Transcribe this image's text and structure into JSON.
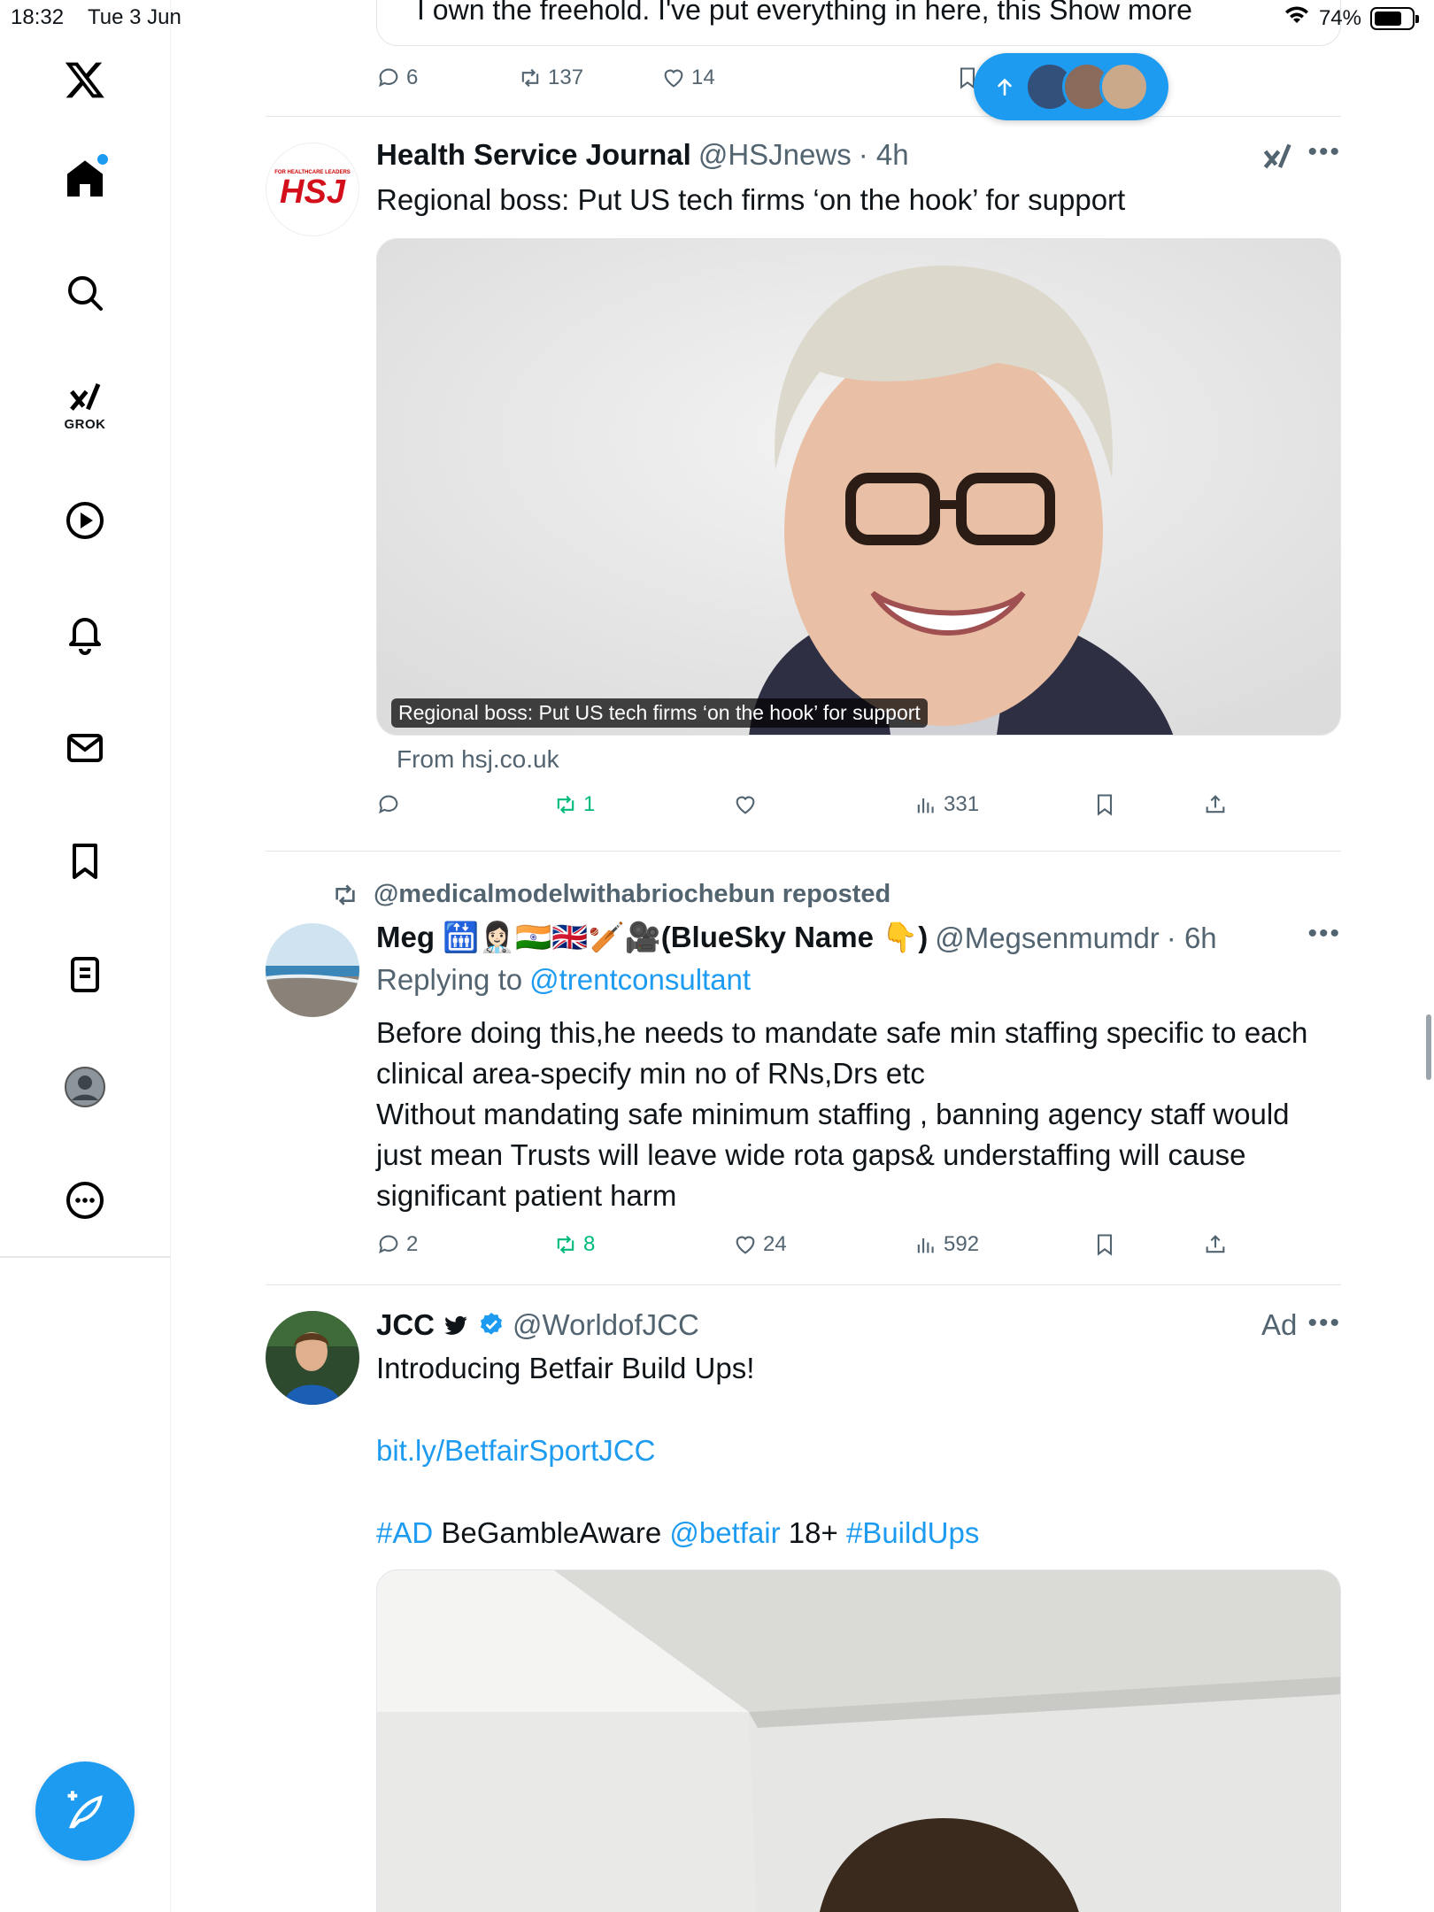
{
  "status_bar": {
    "time": "18:32",
    "date": "Tue 3 Jun",
    "battery_percent": "74%",
    "battery_level": 0.74
  },
  "sidebar": {
    "grok_label": "GROK",
    "items": [
      "x-logo",
      "home",
      "search",
      "grok",
      "video",
      "notifications",
      "messages",
      "bookmarks",
      "lists",
      "profile",
      "more"
    ]
  },
  "new_posts_pill": {
    "accent": "#1d9bf0"
  },
  "prev_tweet": {
    "text_partial": "I own the freehold. I've put everything in here, this",
    "show_more": "Show more",
    "replies": "6",
    "reposts": "137",
    "likes": "14"
  },
  "tweets": [
    {
      "name": "Health Service Journal",
      "handle": "@HSJnews",
      "time": "· 4h",
      "text": "Regional boss: Put US tech firms ‘on the hook’ for support",
      "avatar_text": "HSJ",
      "avatar_subtext": "FOR HEALTHCARE LEADERS",
      "card_caption": "Regional boss: Put US tech firms ‘on the hook’ for support",
      "card_source": "From hsj.co.uk",
      "replies": "",
      "reposts": "1",
      "likes": "",
      "views": "331"
    },
    {
      "reposted_by": "@medicalmodelwithabriochebun reposted",
      "name": "Meg 🛗👩🏻‍⚕️🇮🇳🇬🇧🏏🎥(BlueSky Name 👇)",
      "handle": "@Megsenmumdr",
      "time": "· 6h",
      "replying_prefix": "Replying to",
      "replying_to": "@trentconsultant",
      "text": "Before doing this,he needs to mandate safe min staffing specific to each clinical area-specify min no of RNs,Drs etc\nWithout mandating safe minimum staffing , banning agency staff would just mean Trusts will leave wide rota gaps& understaffing will cause significant patient harm",
      "replies": "2",
      "reposts": "8",
      "likes": "24",
      "views": "592"
    },
    {
      "name": "JCC",
      "handle": "@WorldofJCC",
      "ad_label": "Ad",
      "text": "Introducing Betfair Build Ups!",
      "link": "bit.ly/BetfairSportJCC",
      "hashtag_ad": "#AD",
      "word_gamble": "BeGambleAware",
      "mention_betfair": "@betfair",
      "age": "18+",
      "hashtag_buildups": "#BuildUps"
    }
  ]
}
